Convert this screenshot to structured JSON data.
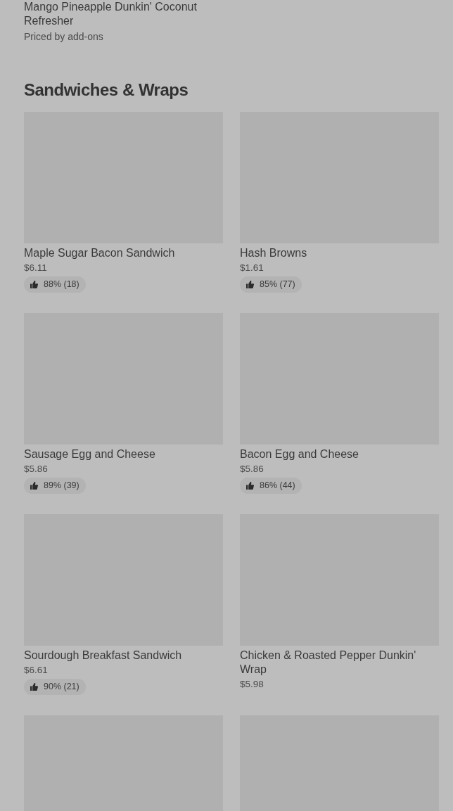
{
  "previous_item": {
    "name": "Mango Pineapple Dunkin' Coconut Refresher",
    "price": "Priced by add-ons"
  },
  "section": {
    "title": "Sandwiches & Wraps",
    "items": [
      {
        "kind": "full",
        "name": "Maple Sugar Bacon Sandwich",
        "price": "$6.11",
        "rating": "88% (18)"
      },
      {
        "kind": "full",
        "name": "Hash Browns",
        "price": "$1.61",
        "rating": "85% (77)"
      },
      {
        "kind": "full",
        "name": "Sausage Egg and Cheese",
        "price": "$5.86",
        "rating": "89% (39)"
      },
      {
        "kind": "full",
        "name": "Bacon Egg and Cheese",
        "price": "$5.86",
        "rating": "86% (44)"
      },
      {
        "kind": "full",
        "name": "Sourdough Breakfast Sandwich",
        "price": "$6.61",
        "rating": "90% (21)"
      },
      {
        "kind": "full",
        "name": "Chicken & Roasted Pepper Dunkin' Wrap",
        "price": "$5.98"
      },
      {
        "kind": "image_only"
      },
      {
        "kind": "image_only"
      }
    ]
  }
}
